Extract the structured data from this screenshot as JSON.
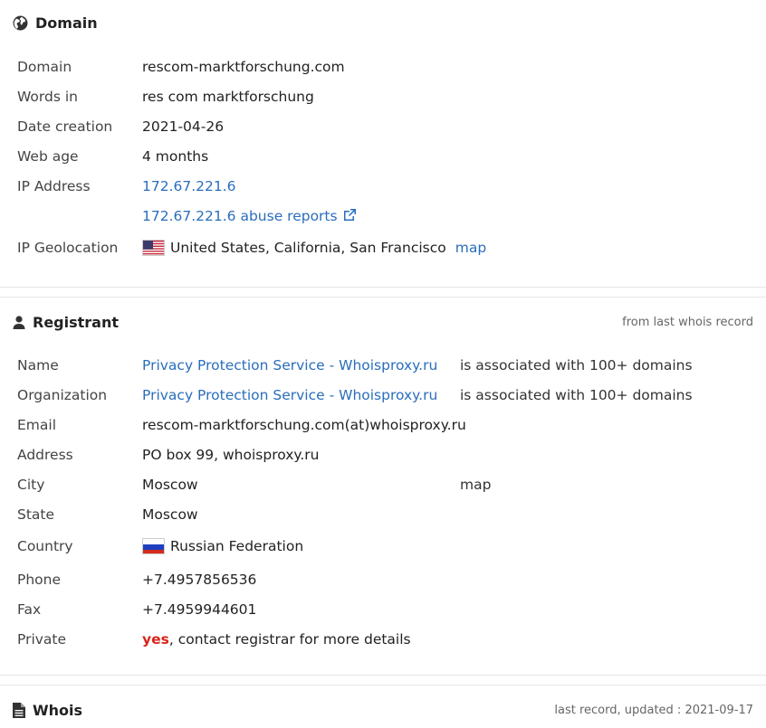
{
  "domain_section": {
    "title": "Domain",
    "rows": [
      {
        "label": "Domain",
        "value": "rescom-marktforschung.com"
      },
      {
        "label": "Words in",
        "value": "res com marktforschung"
      },
      {
        "label": "Date creation",
        "value": "2021-04-26"
      },
      {
        "label": "Web age",
        "value": "4 months"
      },
      {
        "label": "IP Address",
        "value": "172.67.221.6"
      },
      {
        "label": "",
        "value": "172.67.221.6 abuse reports"
      },
      {
        "label": "IP Geolocation",
        "value": "United States, California, San Francisco",
        "link": "map"
      }
    ]
  },
  "registrant_section": {
    "title": "Registrant",
    "note": "from last whois record",
    "rows": [
      {
        "label": "Name",
        "value": "Privacy Protection Service - Whoisproxy.ru",
        "assoc": "is associated with 100+ domains"
      },
      {
        "label": "Organization",
        "value": "Privacy Protection Service - Whoisproxy.ru",
        "assoc": "is associated with 100+ domains"
      },
      {
        "label": "Email",
        "value": "rescom-marktforschung.com(at)whoisproxy.ru"
      },
      {
        "label": "Address",
        "value": "PO box 99, whoisproxy.ru"
      },
      {
        "label": "City",
        "value": "Moscow",
        "link": "map"
      },
      {
        "label": "State",
        "value": "Moscow"
      },
      {
        "label": "Country",
        "value": "Russian Federation"
      },
      {
        "label": "Phone",
        "value": "+7.4957856536"
      },
      {
        "label": "Fax",
        "value": "+7.4959944601"
      },
      {
        "label": "Private",
        "value_highlight": "yes",
        "value": ", contact registrar for more details"
      }
    ]
  },
  "whois_section": {
    "title": "Whois",
    "note": "last record, updated : 2021-09-17"
  },
  "colors": {
    "link": "#2a6ebb",
    "highlight": "#d9231b"
  }
}
